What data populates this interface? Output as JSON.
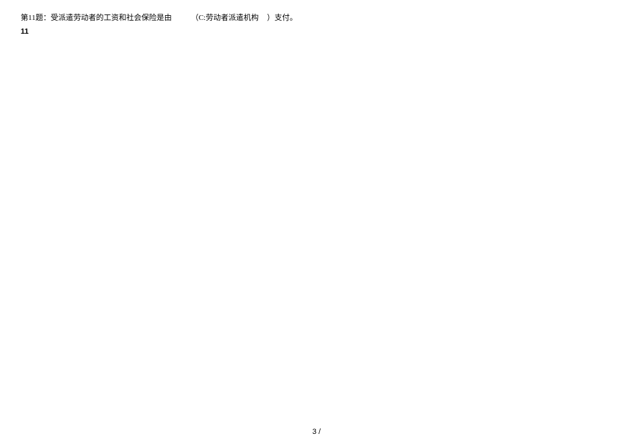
{
  "question": {
    "label": "第11题：",
    "text": "受派遣劳动者的工资和社会保险是由",
    "answerOption": "（C:劳动者派遣机构",
    "closeParen": "）",
    "suffix": "支付。"
  },
  "lineNumber": "11",
  "pageNumber": "3 /"
}
